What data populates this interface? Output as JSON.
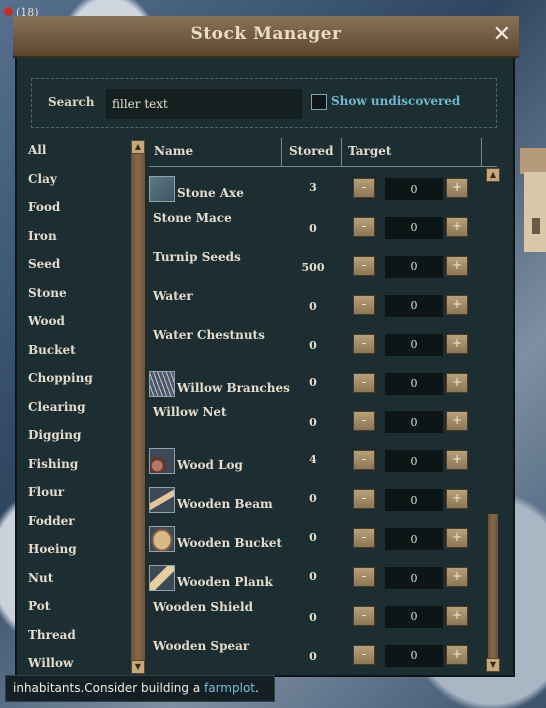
{
  "window": {
    "title": "Stock Manager"
  },
  "hud": {
    "text": "(18)"
  },
  "search": {
    "label": "Search",
    "value": "filler text",
    "show_undiscovered_label": "Show undiscovered"
  },
  "categories": [
    "All",
    "Clay",
    "Food",
    "Iron",
    "Seed",
    "Stone",
    "Wood",
    "Bucket",
    "Chopping",
    "Clearing",
    "Digging",
    "Fishing",
    "Flour",
    "Fodder",
    "Hoeing",
    "Nut",
    "Pot",
    "Thread",
    "Willow"
  ],
  "table": {
    "headers": {
      "name": "Name",
      "stored": "Stored",
      "target": "Target"
    },
    "rows": [
      {
        "name": "Stone Axe",
        "stored": "3",
        "target": "0",
        "icon": "stone-axe-icon"
      },
      {
        "name": "Stone Mace",
        "stored": "0",
        "target": "0",
        "icon": ""
      },
      {
        "name": "Turnip Seeds",
        "stored": "500",
        "target": "0",
        "icon": ""
      },
      {
        "name": "Water",
        "stored": "0",
        "target": "0",
        "icon": ""
      },
      {
        "name": "Water Chestnuts",
        "stored": "0",
        "target": "0",
        "icon": ""
      },
      {
        "name": "Willow Branches",
        "stored": "0",
        "target": "0",
        "icon": "willow-branches-icon"
      },
      {
        "name": "Willow Net",
        "stored": "0",
        "target": "0",
        "icon": ""
      },
      {
        "name": "Wood Log",
        "stored": "4",
        "target": "0",
        "icon": "wood-log-icon"
      },
      {
        "name": "Wooden Beam",
        "stored": "0",
        "target": "0",
        "icon": "wooden-beam-icon"
      },
      {
        "name": "Wooden Bucket",
        "stored": "0",
        "target": "0",
        "icon": "wooden-bucket-icon"
      },
      {
        "name": "Wooden Plank",
        "stored": "0",
        "target": "0",
        "icon": "wooden-plank-icon"
      },
      {
        "name": "Wooden Shield",
        "stored": "0",
        "target": "0",
        "icon": ""
      },
      {
        "name": "Wooden Spear",
        "stored": "0",
        "target": "0",
        "icon": ""
      }
    ],
    "minus_label": "-",
    "plus_label": "+"
  },
  "tooltip": {
    "text": "inhabitants.Consider building a ",
    "link": "farmplot",
    "suffix": "."
  },
  "colors": {
    "panel_bg": "#1d2e33",
    "title_wood": "#6e583f",
    "link": "#6fc0dd",
    "text": "#e4dccb"
  }
}
